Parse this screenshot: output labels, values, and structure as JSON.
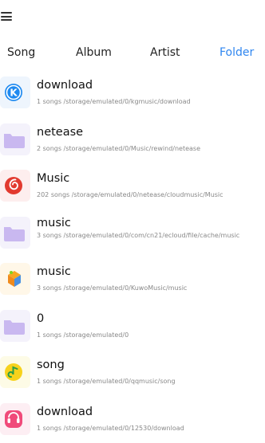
{
  "tabs": [
    {
      "label": "Song",
      "active": false
    },
    {
      "label": "Album",
      "active": false
    },
    {
      "label": "Artist",
      "active": false
    },
    {
      "label": "Folder",
      "active": true
    }
  ],
  "accent_color": "#2f86f0",
  "folders": [
    {
      "name": "download",
      "info": "1 songs /storage/emulated/0/kgmusic/download",
      "icon": "kugou-app-icon"
    },
    {
      "name": "netease",
      "info": "2 songs /storage/emulated/0/Music/rewind/netease",
      "icon": "folder-icon"
    },
    {
      "name": "Music",
      "info": "202 songs /storage/emulated/0/netease/cloudmusic/Music",
      "icon": "netease-music-app-icon"
    },
    {
      "name": "music",
      "info": "3 songs /storage/emulated/0/com/cn21/ecloud/file/cache/music",
      "icon": "folder-icon"
    },
    {
      "name": "music",
      "info": "3 songs /storage/emulated/0/KuwoMusic/music",
      "icon": "kuwo-app-icon"
    },
    {
      "name": "0",
      "info": "1 songs /storage/emulated/0",
      "icon": "folder-icon"
    },
    {
      "name": "song",
      "info": "1 songs /storage/emulated/0/qqmusic/song",
      "icon": "qq-music-app-icon"
    },
    {
      "name": "download",
      "info": "1 songs /storage/emulated/0/12530/download",
      "icon": "migu-app-icon"
    }
  ]
}
